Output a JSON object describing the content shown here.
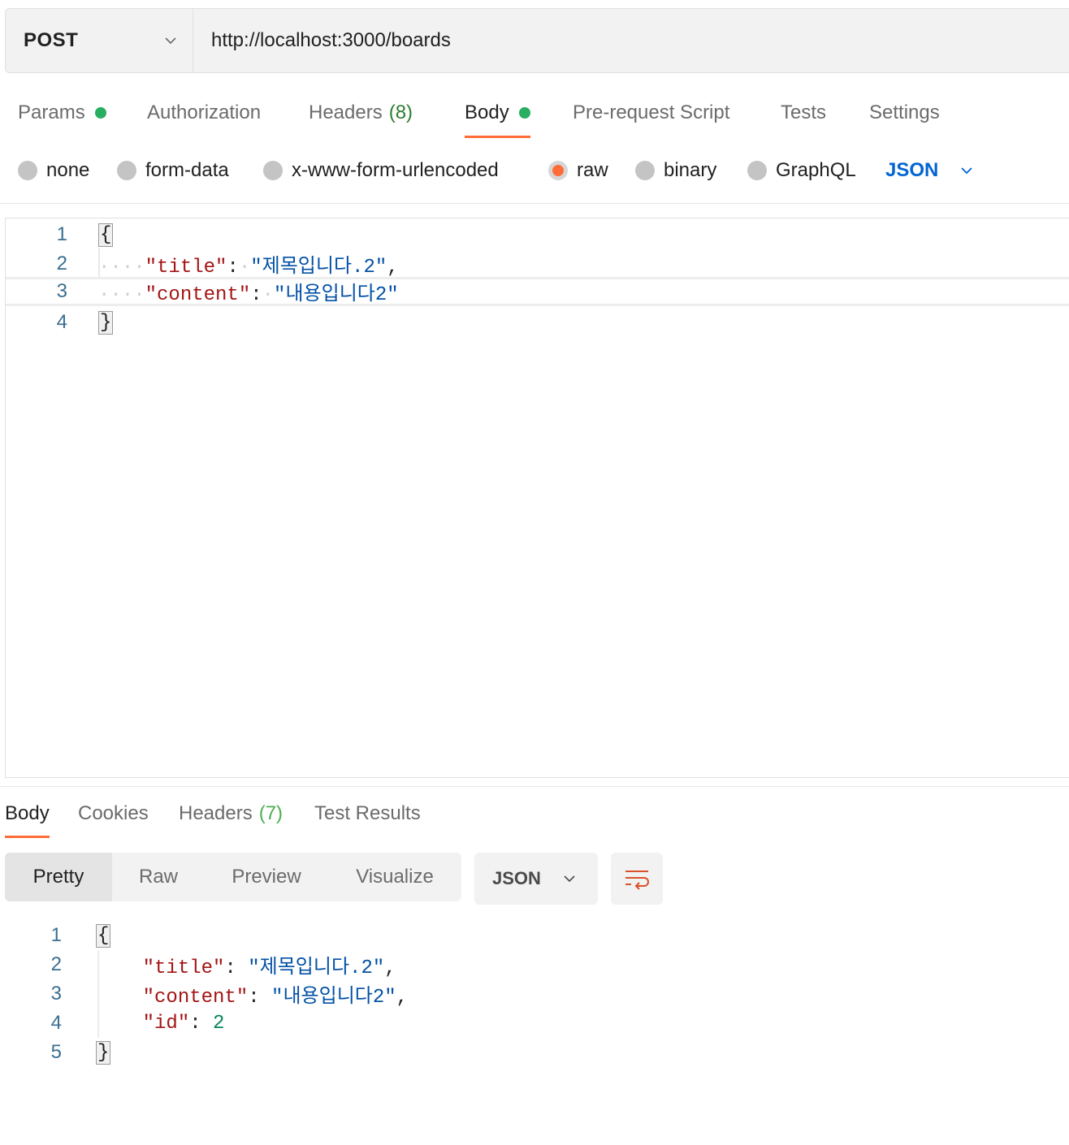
{
  "request": {
    "method": "POST",
    "url": "http://localhost:3000/boards"
  },
  "request_tabs": [
    {
      "label": "Params",
      "dot": true
    },
    {
      "label": "Authorization"
    },
    {
      "label": "Headers",
      "count": "(8)"
    },
    {
      "label": "Body",
      "dot": true,
      "active": true
    },
    {
      "label": "Pre-request Script"
    },
    {
      "label": "Tests"
    },
    {
      "label": "Settings"
    }
  ],
  "body_types": {
    "options": [
      "none",
      "form-data",
      "x-www-form-urlencoded",
      "raw",
      "binary",
      "GraphQL"
    ],
    "selected": "raw",
    "format": "JSON"
  },
  "request_body": {
    "line_numbers": [
      "1",
      "2",
      "3",
      "4"
    ],
    "open_brace": "{",
    "close_brace": "}",
    "title_key": "\"title\"",
    "title_value": "\"제목입니다.2\"",
    "content_key": "\"content\"",
    "content_value": "\"내용입니다2\""
  },
  "response_tabs": [
    {
      "label": "Body",
      "active": true
    },
    {
      "label": "Cookies"
    },
    {
      "label": "Headers",
      "count": "(7)"
    },
    {
      "label": "Test Results"
    }
  ],
  "response_views": [
    "Pretty",
    "Raw",
    "Preview",
    "Visualize"
  ],
  "response_format": "JSON",
  "response_body": {
    "line_numbers": [
      "1",
      "2",
      "3",
      "4",
      "5"
    ],
    "open_brace": "{",
    "close_brace": "}",
    "title_key": "\"title\"",
    "title_value": "\"제목입니다.2\"",
    "content_key": "\"content\"",
    "content_value": "\"내용입니다2\"",
    "id_key": "\"id\"",
    "id_value": "2"
  },
  "colors": {
    "accent": "#ff6c37",
    "dot_green": "#27ae60",
    "link_blue": "#0265d2"
  },
  "icons": [
    "chevron-down-icon",
    "wrap-lines-icon"
  ]
}
